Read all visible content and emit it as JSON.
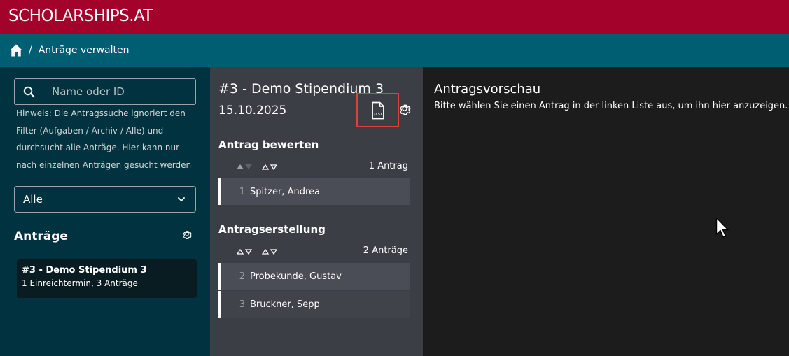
{
  "header": {
    "brand": "SCHOLARSHIPS.AT",
    "bg_color": "#a3022b"
  },
  "breadcrumb": {
    "separator": "/",
    "current": "Anträge verwalten",
    "bg_color": "#005e72",
    "icon": "home-icon"
  },
  "sidebar": {
    "search": {
      "placeholder": "Name oder ID",
      "value": ""
    },
    "hint": "Hinweis: Die Antragssuche ignoriert den Filter (Aufgaben / Archiv / Alle) und durchsucht alle Anträge. Hier kann nur nach einzelnen Anträgen gesucht werden",
    "filter": {
      "selected": "Alle"
    },
    "section_title": "Anträge",
    "cards": [
      {
        "title": "#3 - Demo Stipendium 3",
        "subtitle": "1 Einreichtermin, 3 Anträge"
      }
    ]
  },
  "middle": {
    "title": "#3 - Demo Stipendium 3",
    "date": "15.10.2025",
    "export_icon_label": "XLSX",
    "groups": [
      {
        "title": "Antrag bewerten",
        "count": "1 Antrag",
        "rows": [
          {
            "num": "1",
            "name": "Spitzer, Andrea"
          }
        ]
      },
      {
        "title": "Antragserstellung",
        "count": "2 Anträge",
        "rows": [
          {
            "num": "2",
            "name": "Probekunde, Gustav"
          },
          {
            "num": "3",
            "name": "Bruckner, Sepp"
          }
        ]
      }
    ]
  },
  "preview": {
    "title": "Antragsvorschau",
    "message": "Bitte wählen Sie einen Antrag in der linken Liste aus, um ihn hier anzuzeigen."
  }
}
